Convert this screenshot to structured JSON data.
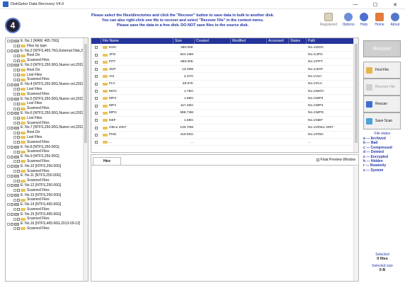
{
  "window": {
    "title": "DiskGetor Data Recovery  V4.0",
    "buttons": [
      "—",
      "☐",
      "✕"
    ]
  },
  "header": {
    "logo_text": "4",
    "notice": [
      "Please select the files/directories and click the \"Recover\" button to save data in bulk to another disk.",
      "You can also right-click one file to recover and select \"Recover File\" in the context menu.",
      "Please save the data to a free disk. DO NOT save files to the source disk."
    ],
    "toolbar": [
      {
        "label": "Registered",
        "icon": "registered-icon"
      },
      {
        "label": "Options",
        "icon": "options-icon"
      },
      {
        "label": "Help",
        "icon": "help-icon"
      },
      {
        "label": "Home",
        "icon": "home-icon"
      },
      {
        "label": "About",
        "icon": "about-icon"
      }
    ]
  },
  "tree": [
    {
      "level": 0,
      "label": "E: No.1 [RAW, 465.76G]",
      "kind": "disk"
    },
    {
      "level": 1,
      "label": "Files by type",
      "kind": "folder"
    },
    {
      "level": 0,
      "label": "E: No.2 [NTFS,465.76G,External Disk,2022-",
      "kind": "disk"
    },
    {
      "level": 1,
      "label": "Root Dir",
      "kind": "folder"
    },
    {
      "level": 1,
      "label": "Scanned Files",
      "kind": "folder"
    },
    {
      "level": 0,
      "label": "E: No.3 [NTFS,250.00G,Nuevo vol,2022-0",
      "kind": "disk"
    },
    {
      "level": 1,
      "label": "Root Dir",
      "kind": "folder"
    },
    {
      "level": 1,
      "label": "Lost Files",
      "kind": "folder"
    },
    {
      "level": 1,
      "label": "Scanned Files",
      "kind": "folder"
    },
    {
      "level": 0,
      "label": "E: No.4 [NTFS,250.00G,Nuevo vol,2022-0",
      "kind": "disk"
    },
    {
      "level": 1,
      "label": "Lost Files",
      "kind": "folder"
    },
    {
      "level": 1,
      "label": "Scanned Files",
      "kind": "folder"
    },
    {
      "level": 0,
      "label": "E: No.5 [NTFS,250.00G,Nuevo vol,2022-0",
      "kind": "disk"
    },
    {
      "level": 1,
      "label": "Lost Files",
      "kind": "folder"
    },
    {
      "level": 1,
      "label": "Scanned Files",
      "kind": "folder"
    },
    {
      "level": 0,
      "label": "E: No.6 [NTFS,250.00G,Nuevo vol,2022-0",
      "kind": "disk"
    },
    {
      "level": 1,
      "label": "Lost Files",
      "kind": "folder"
    },
    {
      "level": 1,
      "label": "Scanned Files",
      "kind": "folder"
    },
    {
      "level": 0,
      "label": "E: No.7 [NTFS,250.00G,Nuevo vol,2022-0",
      "kind": "disk"
    },
    {
      "level": 1,
      "label": "Root Dir",
      "kind": "folder"
    },
    {
      "level": 1,
      "label": "Lost Files",
      "kind": "folder"
    },
    {
      "level": 1,
      "label": "Scanned Files",
      "kind": "folder"
    },
    {
      "level": 0,
      "label": "E: No.8 [NTFS,250.00G]",
      "kind": "disk"
    },
    {
      "level": 1,
      "label": "Scanned Files",
      "kind": "folder"
    },
    {
      "level": 0,
      "label": "E: No.9 [NTFS,250.00G]",
      "kind": "disk"
    },
    {
      "level": 1,
      "label": "Scanned Files",
      "kind": "folder"
    },
    {
      "level": 0,
      "label": "E: No.10 [NTFS,250.00G]",
      "kind": "disk"
    },
    {
      "level": 1,
      "label": "Scanned Files",
      "kind": "folder"
    },
    {
      "level": 0,
      "label": "E: No.11 [NTFS,250.00G]",
      "kind": "disk"
    },
    {
      "level": 1,
      "label": "Scanned Files",
      "kind": "folder"
    },
    {
      "level": 0,
      "label": "E: No.12 [NTFS,250.00G]",
      "kind": "disk"
    },
    {
      "level": 1,
      "label": "Scanned Files",
      "kind": "folder"
    },
    {
      "level": 0,
      "label": "E: No.13 [NTFS,250.00G]",
      "kind": "disk"
    },
    {
      "level": 1,
      "label": "Scanned Files",
      "kind": "folder"
    },
    {
      "level": 0,
      "label": "E: No.14 [NTFS,465.66G]",
      "kind": "disk"
    },
    {
      "level": 1,
      "label": "Scanned Files",
      "kind": "folder"
    },
    {
      "level": 0,
      "label": "E: No.15 [NTFS,465.66G]",
      "kind": "disk"
    },
    {
      "level": 1,
      "label": "Scanned Files",
      "kind": "folder"
    },
    {
      "level": 0,
      "label": "E: No.16 [NTFS,465.66G,2013-09-12]",
      "kind": "disk"
    },
    {
      "level": 1,
      "label": "Scanned Files",
      "kind": "folder"
    }
  ],
  "files": {
    "columns": [
      "",
      "File Name",
      "Size",
      "Created",
      "Modified",
      "Accessed",
      "States",
      "Path"
    ],
    "rows": [
      {
        "name": "DOC",
        "size": "360.00K",
        "path": "No.1\\DOC"
      },
      {
        "name": "JPG",
        "size": "944.19M",
        "path": "No.1\\JPG"
      },
      {
        "name": "PPT",
        "size": "880.00K",
        "path": "No.1\\PPT"
      },
      {
        "name": "3GP",
        "size": "13.49M",
        "path": "No.1\\3GP"
      },
      {
        "name": "AVI",
        "size": "2.37G",
        "path": "No.1\\AVI"
      },
      {
        "name": "FLV",
        "size": "28.97K",
        "path": "No.1\\FLV"
      },
      {
        "name": "MOV",
        "size": "1.75G",
        "path": "No.1\\MOV"
      },
      {
        "name": "MP3",
        "size": "1.88G",
        "path": "No.1\\MP3"
      },
      {
        "name": "MP4",
        "size": "117.46G",
        "path": "No.1\\MP4"
      },
      {
        "name": "MPG",
        "size": "988.73M",
        "path": "No.1\\MPG"
      },
      {
        "name": "NEF",
        "size": "1.58G",
        "path": "No.1\\NEF"
      },
      {
        "name": "Office 2007",
        "size": "133.70M",
        "path": "No.1\\Office 2007"
      },
      {
        "name": "PNG",
        "size": "419.92G",
        "path": "No.1\\PNG"
      },
      {
        "name": "...",
        "size": "...",
        "path": "..."
      }
    ]
  },
  "preview": {
    "tab": "Hex",
    "float_label": "Float Preview Window"
  },
  "side": {
    "recover": "Recover",
    "find_file": "Find File",
    "recover_file": "Recover File",
    "rescan": "Rescan",
    "save_scan": "Save Scan",
    "states_title": "File states",
    "states": [
      "a --- Archived",
      "b --- Bad",
      "c --- Compressed",
      "d --- Deleted",
      "e --- Encrypted",
      "h --- Hidden",
      "r --- Readonly",
      "s --- System"
    ],
    "selected_label": "Selected",
    "selected_value": "0 files",
    "size_label": "Selected size",
    "size_value": "0 B"
  }
}
